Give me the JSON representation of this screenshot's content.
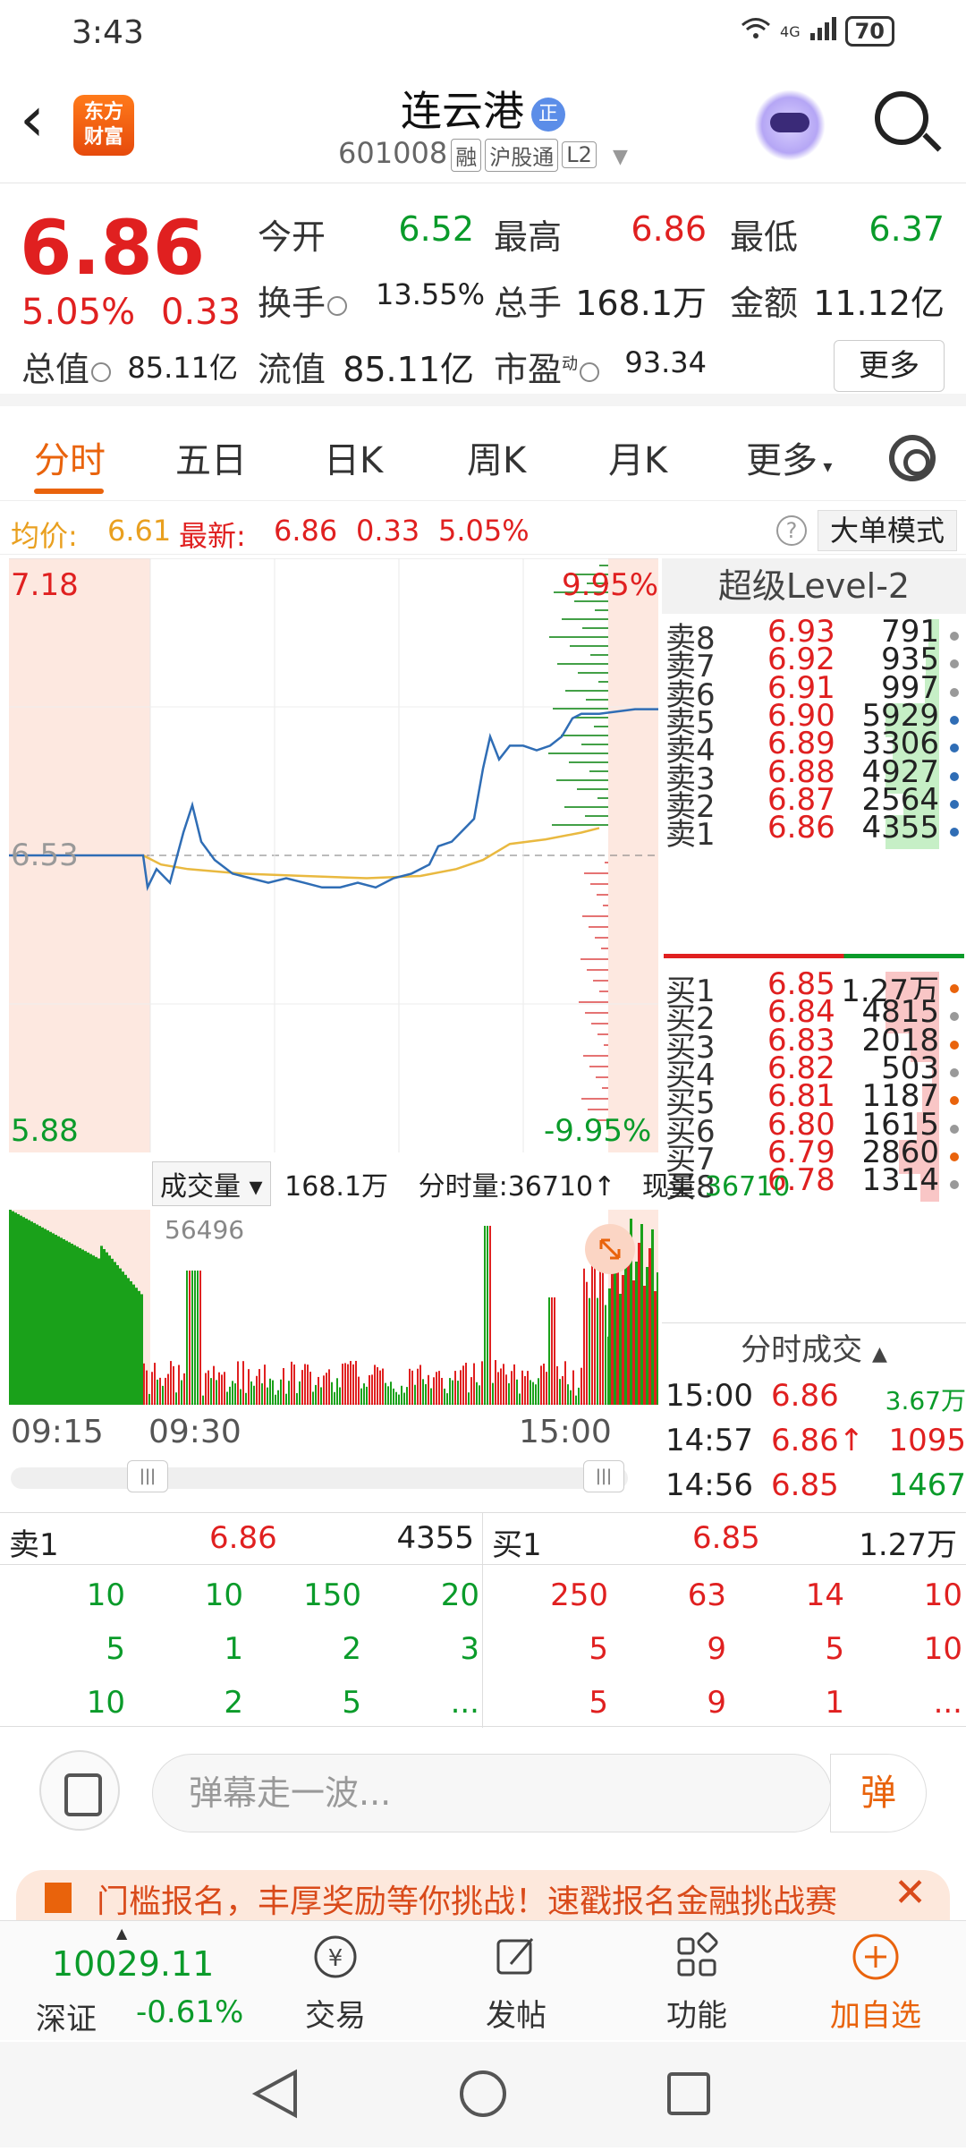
{
  "status": {
    "time": "3:43",
    "network": "4G",
    "battery": "70"
  },
  "header": {
    "logo_text": "东方财富",
    "stock_name": "连云港",
    "zheng_badge": "正",
    "code": "601008",
    "tags": [
      "融",
      "沪股通",
      "L2"
    ]
  },
  "quote": {
    "price": "6.86",
    "pct": "5.05%",
    "change": "0.33",
    "open_label": "今开",
    "open": "6.52",
    "high_label": "最高",
    "high": "6.86",
    "low_label": "最低",
    "low": "6.37",
    "turnover_label": "换手",
    "turnover": "13.55%",
    "volume_label": "总手",
    "volume": "168.1万",
    "amount_label": "金额",
    "amount": "11.12亿",
    "mktcap_label": "总值",
    "mktcap": "85.11亿",
    "float_label": "流值",
    "float": "85.11亿",
    "pe_label": "市盈",
    "pe_sup": "动",
    "pe": "93.34",
    "more": "更多"
  },
  "tabs": [
    "分时",
    "五日",
    "日K",
    "周K",
    "月K",
    "更多"
  ],
  "avgline": {
    "avg_label": "均价:",
    "avg": "6.61",
    "latest_label": "最新:",
    "latest": "6.86",
    "change": "0.33",
    "pct": "5.05%",
    "big_order": "大单模式",
    "help": "?"
  },
  "chart_labels": {
    "top_price": "7.18",
    "mid_price": "6.53",
    "bottom_price": "5.88",
    "top_pct": "9.95%",
    "bottom_pct": "-9.95%"
  },
  "orderbook": {
    "title": "超级Level-2",
    "sells": [
      {
        "label": "卖8",
        "price": "6.93",
        "vol": "791"
      },
      {
        "label": "卖7",
        "price": "6.92",
        "vol": "935"
      },
      {
        "label": "卖6",
        "price": "6.91",
        "vol": "997"
      },
      {
        "label": "卖5",
        "price": "6.90",
        "vol": "5929"
      },
      {
        "label": "卖4",
        "price": "6.89",
        "vol": "3306"
      },
      {
        "label": "卖3",
        "price": "6.88",
        "vol": "4927"
      },
      {
        "label": "卖2",
        "price": "6.87",
        "vol": "2564"
      },
      {
        "label": "卖1",
        "price": "6.86",
        "vol": "4355"
      }
    ],
    "buys": [
      {
        "label": "买1",
        "price": "6.85",
        "vol": "1.27万"
      },
      {
        "label": "买2",
        "price": "6.84",
        "vol": "4815"
      },
      {
        "label": "买3",
        "price": "6.83",
        "vol": "2018"
      },
      {
        "label": "买4",
        "price": "6.82",
        "vol": "503"
      },
      {
        "label": "买5",
        "price": "6.81",
        "vol": "1187"
      },
      {
        "label": "买6",
        "price": "6.80",
        "vol": "1615"
      },
      {
        "label": "买7",
        "price": "6.79",
        "vol": "2860"
      },
      {
        "label": "买8",
        "price": "6.78",
        "vol": "1314"
      }
    ]
  },
  "volume": {
    "label": "成交量",
    "total": "168.1万",
    "minute_label": "分时量:",
    "minute": "36710↑",
    "now_label": "现量:",
    "now": "36710",
    "peak": "56496"
  },
  "time_axis": [
    "09:15",
    "09:30",
    "15:00"
  ],
  "ticks": {
    "title": "分时成交",
    "rows": [
      {
        "time": "15:00",
        "price": "6.86",
        "vol": "3.67万"
      },
      {
        "time": "14:57",
        "price": "6.86↑",
        "vol": "1095"
      },
      {
        "time": "14:56",
        "price": "6.85",
        "vol": "1467"
      }
    ]
  },
  "detail": {
    "sell_label": "卖1",
    "sell_price": "6.86",
    "sell_vol": "4355",
    "buy_label": "买1",
    "buy_price": "6.85",
    "buy_vol": "1.27万",
    "sell_rows": [
      [
        "10",
        "10",
        "150",
        "20"
      ],
      [
        "5",
        "1",
        "2",
        "3"
      ],
      [
        "10",
        "2",
        "5",
        "..."
      ]
    ],
    "buy_rows": [
      [
        "250",
        "63",
        "14",
        "10"
      ],
      [
        "5",
        "9",
        "5",
        "10"
      ],
      [
        "5",
        "9",
        "1",
        "..."
      ]
    ]
  },
  "danmu": {
    "placeholder": "弹幕走一波...",
    "button": "弹"
  },
  "banner": {
    "text": "门槛报名，丰厚奖励等你挑战！速戳报名金融挑战赛"
  },
  "bottom": {
    "index_value": "10029.11",
    "index_name": "深证",
    "index_pct": "-0.61%",
    "nav": [
      "交易",
      "发帖",
      "功能",
      "加自选"
    ]
  },
  "colors": {
    "up": "#e02020",
    "down": "#0a9b2a",
    "accent": "#e9630c",
    "avg_line": "#e9b940",
    "price_line": "#2f6db5"
  }
}
